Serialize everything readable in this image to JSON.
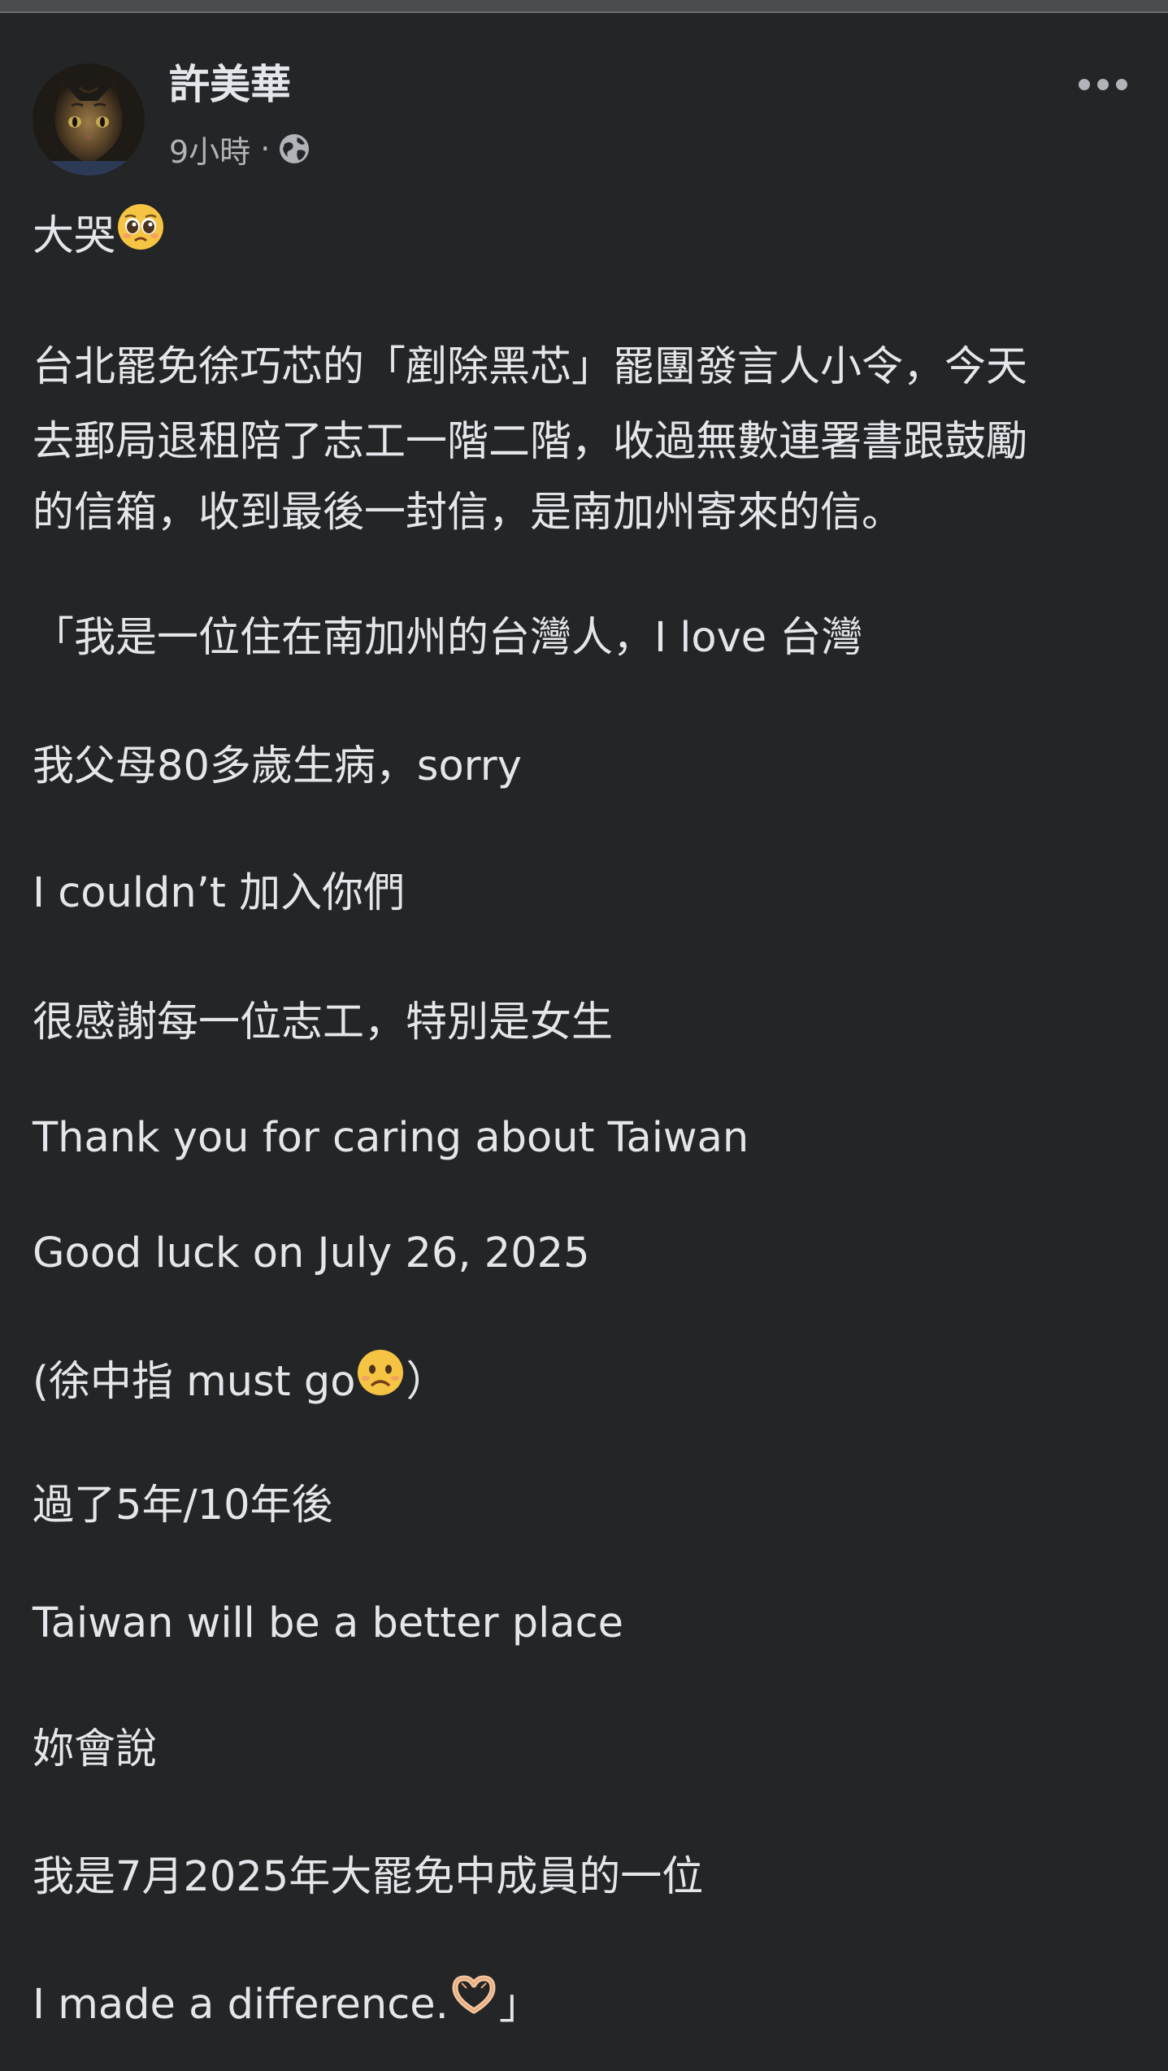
{
  "post": {
    "author": "許美華",
    "time": "9小時",
    "separator": "·",
    "privacy_icon": "globe-icon",
    "more_icon": "more-dots-icon",
    "lines": {
      "l1": "大哭",
      "l2": "台北罷免徐巧芯的「剷除黑芯」罷團發言人小令，今天",
      "l3": "去郵局退租陪了志工一階二階，收過無數連署書跟鼓勵",
      "l4": "的信箱，收到最後一封信，是南加州寄來的信。",
      "l5": "「我是一位住在南加州的台灣人，I love 台灣",
      "l6": "我父母80多歲生病，sorry",
      "l7": "I couldn’t 加入你們",
      "l8": "很感謝每一位志工，特別是女生",
      "l9": "Thank you for caring about Taiwan",
      "l10": "Good luck on July 26, 2025",
      "l11a": "(徐中指 must go",
      "l11b": "）",
      "l12": "過了5年/10年後",
      "l13": "Taiwan will be a better place",
      "l14": "妳會說",
      "l15": "我是7月2025年大罷免中成員的一位",
      "l16a": "I made a difference.",
      "l16b": "」"
    },
    "emojis": {
      "crying_face": "pleading-face-emoji",
      "frown_face": "frowning-face-emoji",
      "heart_hands": "heart-hands-emoji"
    }
  }
}
